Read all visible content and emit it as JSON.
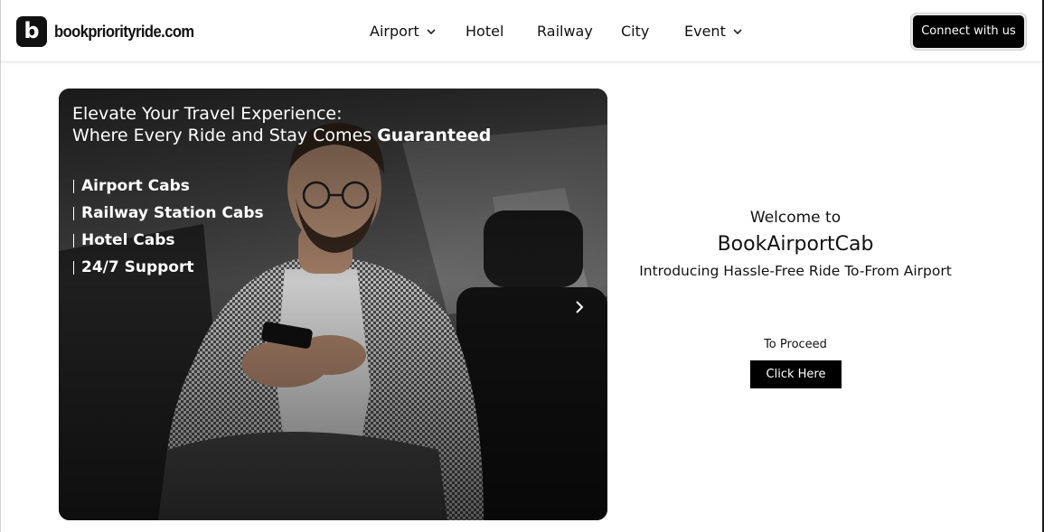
{
  "brand": {
    "logo_letter": "b",
    "site_name": "bookpriorityride.com"
  },
  "nav": {
    "items": [
      {
        "label": "Airport",
        "has_dropdown": true
      },
      {
        "label": "Hotel",
        "has_dropdown": false
      },
      {
        "label": "Railway",
        "has_dropdown": false
      },
      {
        "label": "City",
        "has_dropdown": false
      },
      {
        "label": "Event",
        "has_dropdown": true
      }
    ],
    "connect_label": "Connect with us"
  },
  "hero": {
    "line1": "Elevate Your Travel Experience:",
    "line2_prefix": "Where Every Ride and Stay Comes ",
    "line2_bold": "Guaranteed",
    "features": [
      "Airport Cabs",
      "Railway Station Cabs",
      "Hotel Cabs",
      "24/7 Support"
    ],
    "next_icon": "chevron-right-icon"
  },
  "welcome": {
    "greeting": "Welcome to",
    "brand_name": "BookAirportCab",
    "tagline": "Introducing Hassle-Free Ride To-From Airport",
    "proceed_label": "To Proceed",
    "cta_label": "Click Here"
  },
  "colors": {
    "primary": "#000000",
    "background": "#ffffff",
    "text": "#111111"
  }
}
